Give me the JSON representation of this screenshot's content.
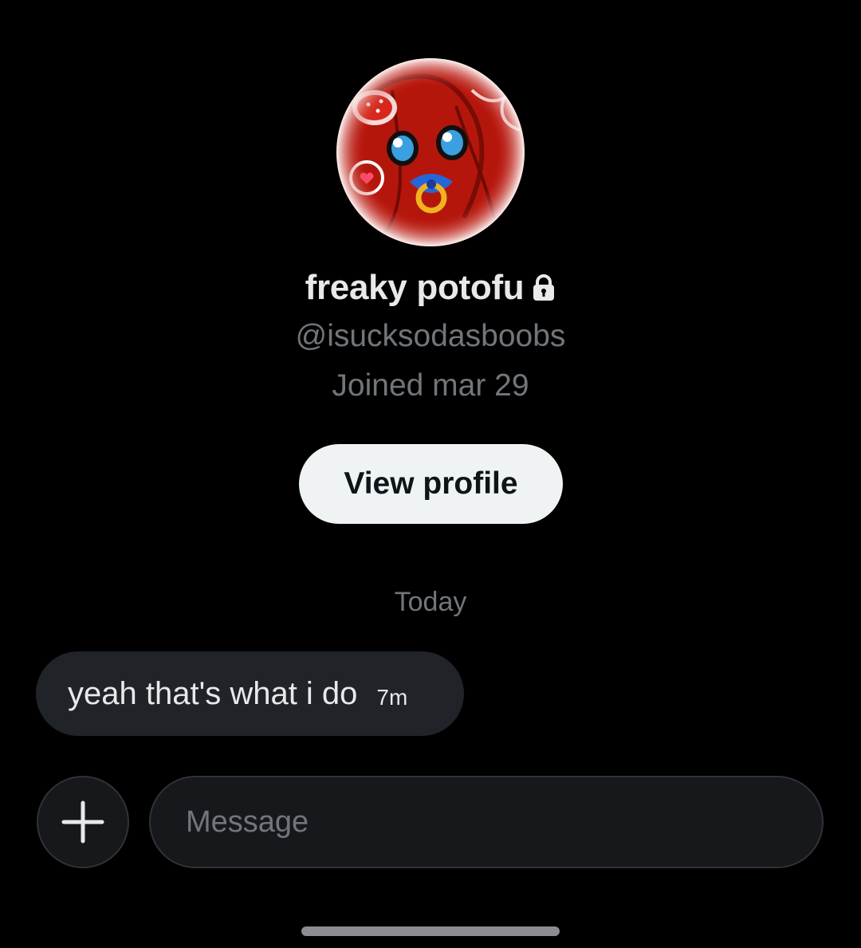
{
  "profile": {
    "display_name": "freaky potofu",
    "handle": "@isucksodasboobs",
    "joined": "Joined mar 29",
    "view_profile_label": "View profile",
    "avatar_icon": "avatar-image",
    "locked_icon": "lock-icon"
  },
  "conversation": {
    "day_label": "Today",
    "messages": [
      {
        "text": "yeah that's what i do",
        "time": "7m",
        "direction": "incoming"
      }
    ]
  },
  "composer": {
    "placeholder": "Message",
    "value": "",
    "add_icon": "plus-icon"
  },
  "colors": {
    "background": "#000000",
    "primary_text": "#e7e9ea",
    "secondary_text": "#71767b",
    "bubble": "#202327",
    "button_bg": "#eff3f4"
  }
}
